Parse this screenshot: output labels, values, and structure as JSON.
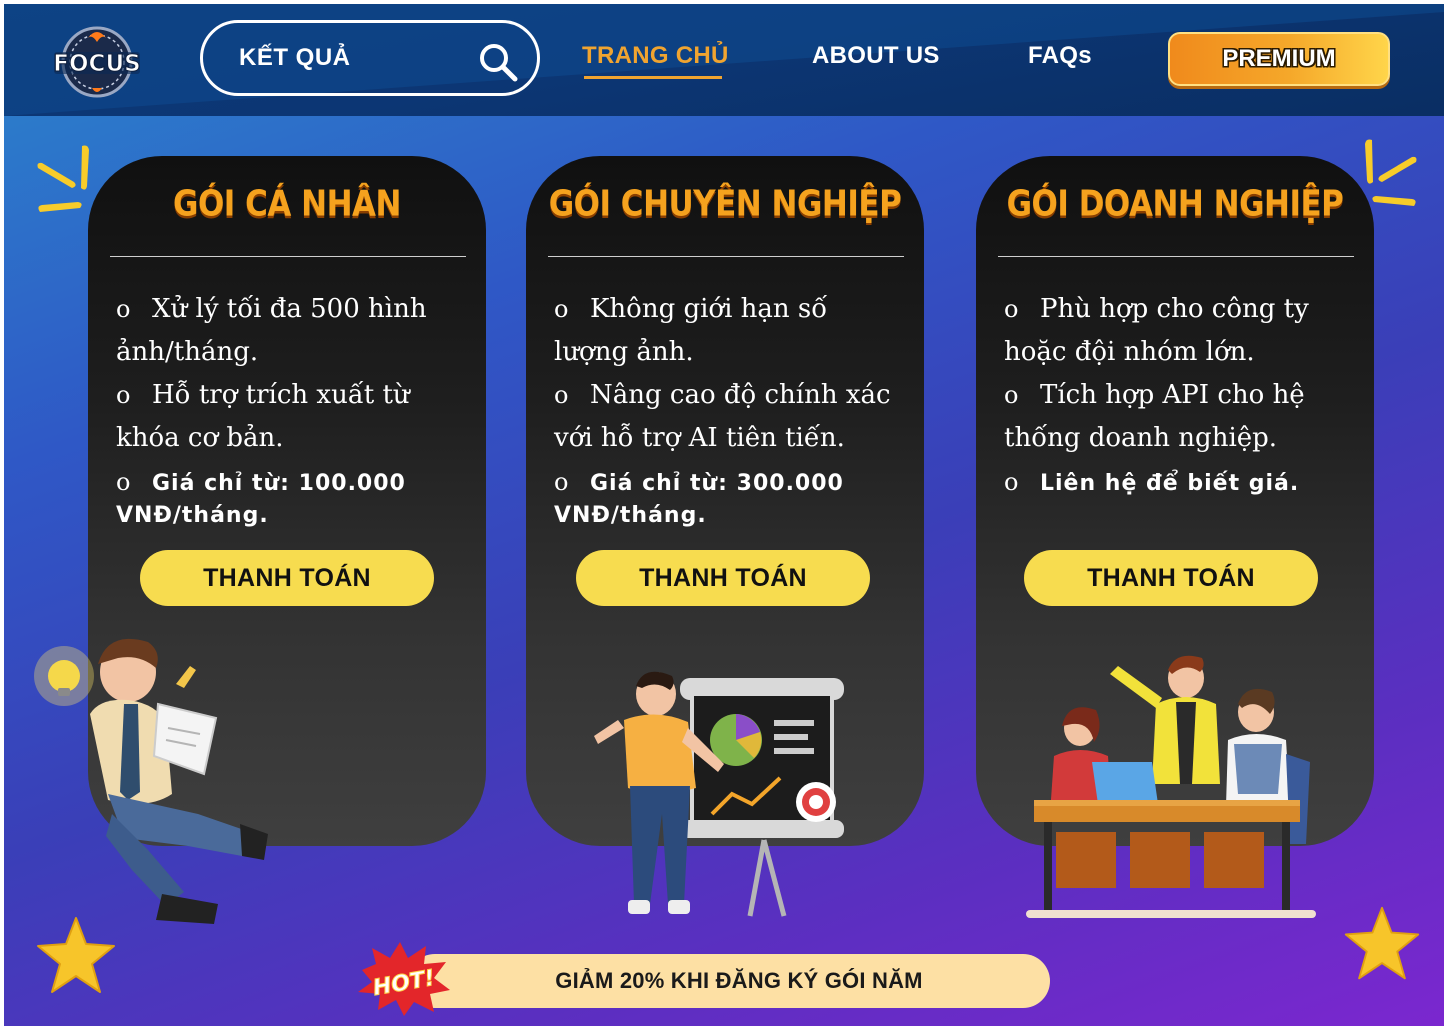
{
  "header": {
    "logo_text": "FOCUS",
    "search": {
      "value": "KẾT QUẢ",
      "icon": "search-icon"
    },
    "nav": [
      {
        "label": "TRANG CHỦ",
        "active": true
      },
      {
        "label": "ABOUT US",
        "active": false
      },
      {
        "label": "FAQs",
        "active": false
      }
    ],
    "premium_label": "PREMIUM"
  },
  "plans": [
    {
      "title": "GÓI CÁ NHÂN",
      "features": [
        "Xử lý tối đa 500 hình ảnh/tháng.",
        "Hỗ trợ trích xuất từ khóa cơ bản."
      ],
      "price": "Giá chỉ từ: 100.000 VNĐ/tháng.",
      "button": "THANH TOÁN"
    },
    {
      "title": "GÓI CHUYÊN NGHIỆP",
      "features": [
        "Không giới hạn số lượng ảnh.",
        "Nâng cao độ chính xác với hỗ trợ AI tiên tiến."
      ],
      "price": "Giá chỉ từ: 300.000 VNĐ/tháng.",
      "button": "THANH TOÁN"
    },
    {
      "title": "GÓI DOANH NGHIỆP",
      "features": [
        "Phù hợp cho công ty hoặc đội nhóm lớn.",
        "Tích hợp API cho hệ thống doanh nghiệp."
      ],
      "price": "Liên hệ để biết giá.",
      "button": "THANH TOÁN"
    }
  ],
  "bullet": "o",
  "promo": {
    "badge": "HOT!",
    "text": "GIẢM 20% KHI ĐĂNG KÝ GÓI NĂM"
  },
  "colors": {
    "accent_orange": "#f0a430",
    "title_gold": "#f5a21e",
    "button_yellow": "#f7dc4f",
    "promo_bg": "#fde0a4",
    "card_bg": "#1a1a1a"
  }
}
